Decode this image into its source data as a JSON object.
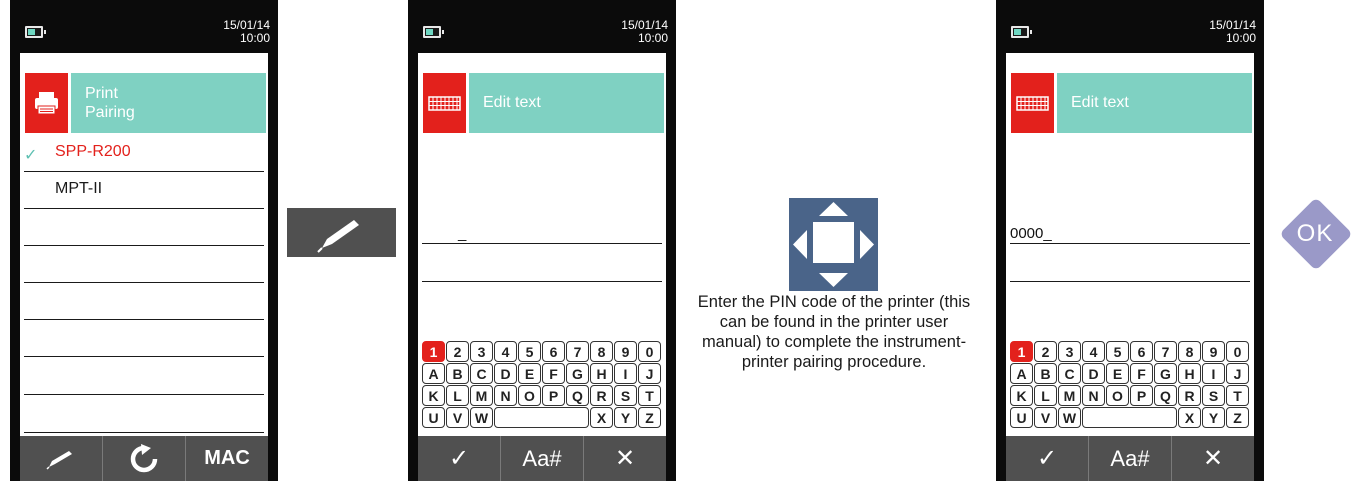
{
  "screen1": {
    "date": "15/01/14",
    "time": "10:00",
    "title_line1": "Print",
    "title_line2": "Pairing",
    "title_icon": "printer-icon",
    "items": [
      {
        "label": "SPP-R200",
        "selected": true
      },
      {
        "label": "MPT-II",
        "selected": false
      },
      {
        "label": "",
        "selected": false
      },
      {
        "label": "",
        "selected": false
      },
      {
        "label": "",
        "selected": false
      },
      {
        "label": "",
        "selected": false
      },
      {
        "label": "",
        "selected": false
      },
      {
        "label": "",
        "selected": false
      }
    ],
    "softkeys": {
      "edit_icon": "pencil-icon",
      "refresh_icon": "refresh-icon",
      "mac_label": "MAC"
    }
  },
  "arrow_step1": {
    "icon": "pencil-icon"
  },
  "screen2": {
    "date": "15/01/14",
    "time": "10:00",
    "title": "Edit text",
    "title_icon": "keyboard-icon",
    "value": "_",
    "softkeys": {
      "confirm_label": "✓",
      "mode_label": "Aa#",
      "cancel_label": "✕"
    }
  },
  "arrow_step2": {
    "icon": "navigation-arrows-icon"
  },
  "caption": "Enter the PIN code of the printer (this can be found in the printer user manual) to complete the instrument-printer pairing procedure.",
  "screen3": {
    "date": "15/01/14",
    "time": "10:00",
    "title": "Edit text",
    "title_icon": "keyboard-icon",
    "value": "0000_",
    "softkeys": {
      "confirm_label": "✓",
      "mode_label": "Aa#",
      "cancel_label": "✕"
    }
  },
  "keyboard": {
    "rows": [
      [
        "1",
        "2",
        "3",
        "4",
        "5",
        "6",
        "7",
        "8",
        "9",
        "0"
      ],
      [
        "A",
        "B",
        "C",
        "D",
        "E",
        "F",
        "G",
        "H",
        "I",
        "J"
      ],
      [
        "K",
        "L",
        "M",
        "N",
        "O",
        "P",
        "Q",
        "R",
        "S",
        "T"
      ],
      [
        "U",
        "V",
        "W",
        " ",
        "X",
        "Y",
        "Z"
      ]
    ],
    "active_key": "1"
  },
  "ok_button": {
    "label": "OK",
    "color": "#9a99c8"
  },
  "colors": {
    "accent_red": "#e3211c",
    "accent_teal": "#7fd1c2",
    "softkey_bg": "#505050",
    "nav_blue": "#4a6489"
  }
}
